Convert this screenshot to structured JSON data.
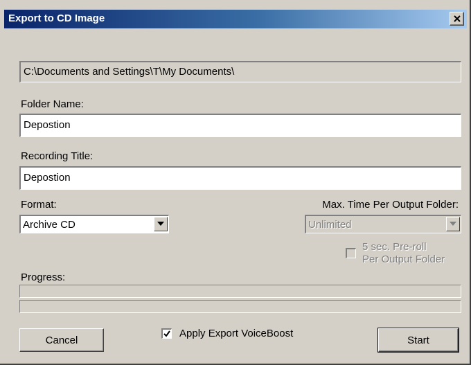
{
  "window": {
    "title": "Export to CD Image"
  },
  "path": {
    "value": "C:\\Documents and Settings\\T\\My Documents\\"
  },
  "folder_name": {
    "label": "Folder Name:",
    "value": "Depostion"
  },
  "recording_title": {
    "label": "Recording Title:",
    "value": "Depostion"
  },
  "format": {
    "label": "Format:",
    "selected": "Archive CD"
  },
  "max_time": {
    "label": "Max. Time Per Output Folder:",
    "selected": "Unlimited",
    "enabled": false
  },
  "preroll": {
    "line1": "5 sec. Pre-roll",
    "line2": "Per Output Folder",
    "checked": false,
    "enabled": false
  },
  "progress": {
    "label": "Progress:",
    "bar1_fraction": 0,
    "bar2_fraction": 0
  },
  "voiceboost": {
    "label": "Apply Export VoiceBoost",
    "checked": true
  },
  "buttons": {
    "cancel": "Cancel",
    "start": "Start"
  },
  "icons": {
    "close": "close-x-icon",
    "dropdown": "chevron-down-icon",
    "check": "checkmark-icon"
  }
}
